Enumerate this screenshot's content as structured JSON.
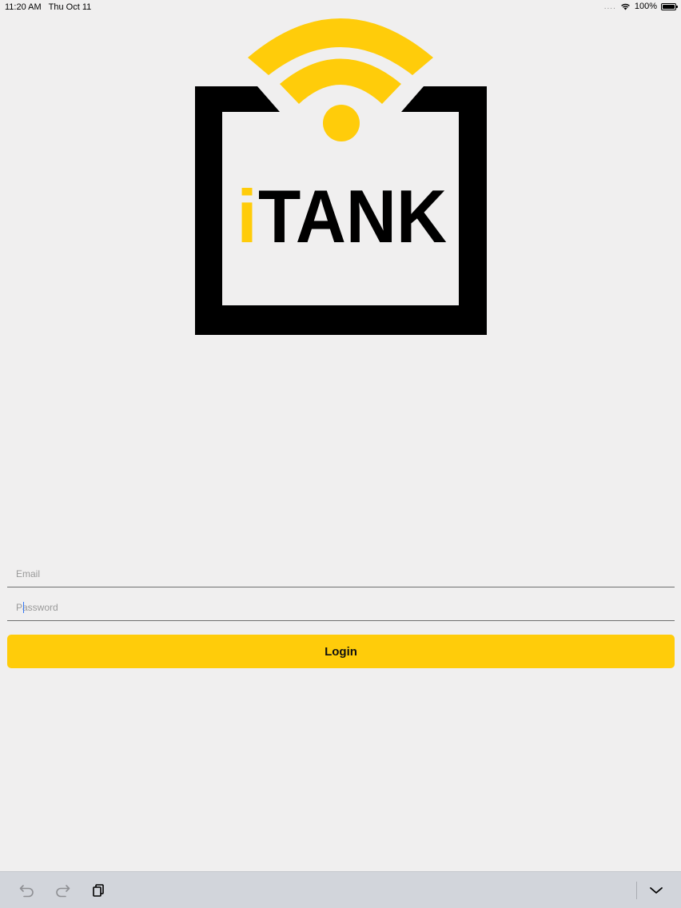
{
  "status_bar": {
    "time": "11:20 AM",
    "date": "Thu Oct 11",
    "signal": "....",
    "battery": "100%",
    "icons": [
      "wifi-icon",
      "battery-icon"
    ]
  },
  "logo": {
    "text_prefix": "i",
    "text_main": "TANK",
    "colors": {
      "yellow": "#ffcc0a",
      "black": "#000000"
    }
  },
  "form": {
    "email_placeholder": "Email",
    "email_value": "",
    "password_placeholder": "Password",
    "password_value": "",
    "login_label": "Login"
  },
  "shortcut_bar": {
    "icons": [
      "undo-icon",
      "redo-icon",
      "paste-icon",
      "keyboard-dismiss-icon"
    ]
  },
  "colors": {
    "background": "#f0efef",
    "accent": "#ffcc0a",
    "caret": "#3478f6",
    "toolbar": "#d2d5db"
  }
}
